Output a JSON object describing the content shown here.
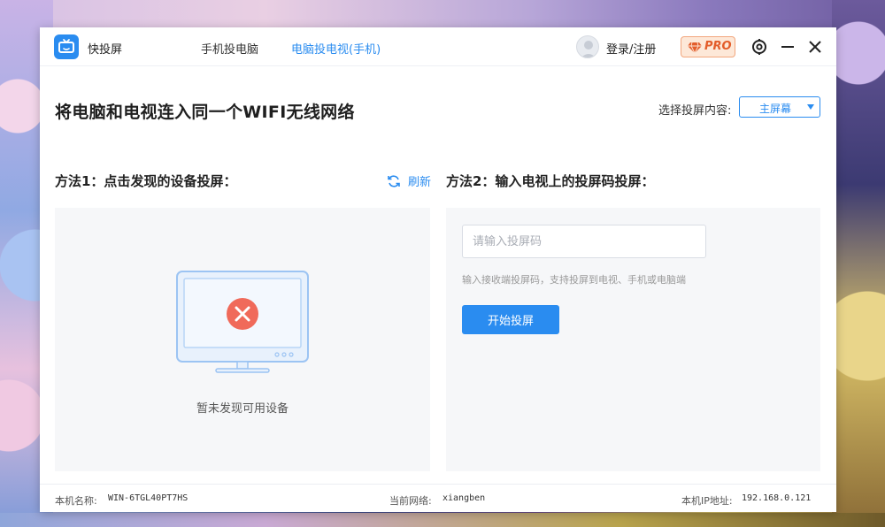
{
  "app": {
    "name": "快投屏"
  },
  "tabs": [
    {
      "label": "手机投电脑",
      "active": false
    },
    {
      "label": "电脑投电视(手机)",
      "active": true
    }
  ],
  "user": {
    "login_label": "登录/注册"
  },
  "pro": {
    "label": "PRO"
  },
  "main": {
    "headline": "将电脑和电视连入同一个WIFI无线网络",
    "select": {
      "label": "选择投屏内容:",
      "value": "主屏幕"
    }
  },
  "method1": {
    "title": "方法1：点击发现的设备投屏：",
    "refresh_label": "刷新",
    "empty_text": "暂未发现可用设备"
  },
  "method2": {
    "title": "方法2：输入电视上的投屏码投屏：",
    "input_placeholder": "请输入投屏码",
    "input_value": "",
    "hint": "输入接收端投屏码，支持投屏到电视、手机或电脑端",
    "start_label": "开始投屏"
  },
  "footer": {
    "host_label": "本机名称:",
    "host_value": "WIN-6TGL40PT7HS",
    "network_label": "当前网络:",
    "network_value": "xiangben",
    "ip_label": "本机IP地址:",
    "ip_value": "192.168.0.121"
  },
  "colors": {
    "accent": "#2a8cf0",
    "pro_text": "#e35d2b",
    "error_red": "#f06a5a",
    "panel_bg": "#f6f7f9"
  },
  "icons": {
    "app_logo": "tv-icon",
    "avatar": "user-avatar-icon",
    "pro": "diamond-icon",
    "settings": "gear-icon",
    "minimize": "minimize-icon",
    "close": "close-icon",
    "refresh": "refresh-icon",
    "dropdown": "caret-down-icon",
    "empty": "monitor-error-icon"
  }
}
